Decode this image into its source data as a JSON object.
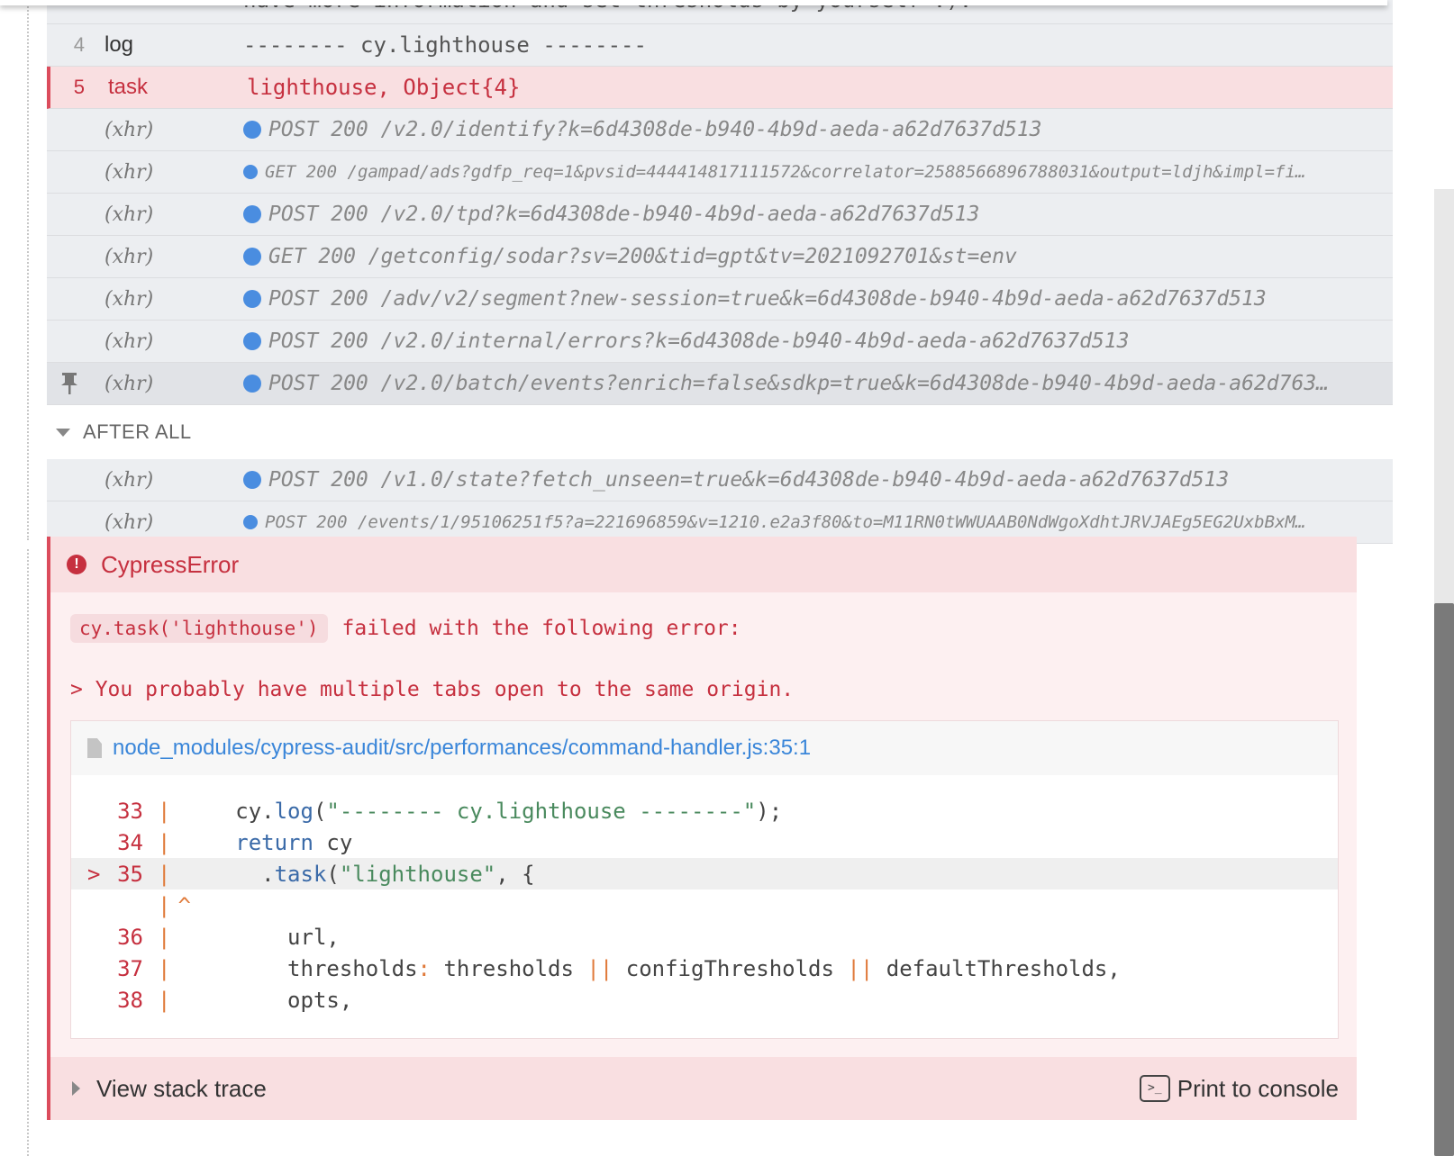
{
  "commands": [
    {
      "num": "",
      "name": "",
      "message": "have more information and set thresholds by yourself :)."
    },
    {
      "num": "4",
      "name": "log",
      "message": "-------- cy.lighthouse --------"
    },
    {
      "num": "5",
      "name": "task",
      "message": "lighthouse, Object{4}"
    }
  ],
  "xhr_label": "(xhr)",
  "xhr_requests": [
    "POST 200 /v2.0/identify?k=6d4308de-b940-4b9d-aeda-a62d7637d513",
    "GET 200 /gampad/ads?gdfp_req=1&pvsid=4444148171115​72&correlator=2588566896788031&output=ldjh&impl=fi…",
    "POST 200 /v2.0/tpd?k=6d4308de-b940-4b9d-aeda-a62d7637d513",
    "GET 200 /getconfig/sodar?sv=200&tid=gpt&tv=2021092701&st=env",
    "POST 200 /adv/v2/segment?new-session=true&k=6d4308de-b940-4b9d-aeda-a62d7637d513",
    "POST 200 /v2.0/internal/errors?k=6d4308de-b940-4b9d-aeda-a62d7637d513",
    "POST 200 /v2.0/batch/events?enrich=false&sdkp=true&k=6d4308de-b940-4b9d-aeda-a62d763…"
  ],
  "after_all": {
    "label": "AFTER ALL",
    "requests": [
      "POST 200 /v1.0/state?fetch_unseen=true&k=6d4308de-b940-4b9d-aeda-a62d7637d513",
      "POST 200 /events/1/95106251f5?a=221696859&v=1210.e2a3f80&to=M11RN0tWWUAAB0NdWgoXdhtJRVJAEg5EG2UxbBxM…"
    ]
  },
  "error": {
    "title": "CypressError",
    "code_chip": "cy.task('lighthouse')",
    "message_rest": "failed with the following error:",
    "message_line2": "> You probably have multiple tabs open to the same origin.",
    "file_path": "node_modules/cypress-audit/src/performances/command-handler.js:35:1",
    "code_lines": [
      {
        "ln": "33",
        "text": "    cy.log(\"-------- cy.lighthouse --------\");"
      },
      {
        "ln": "34",
        "text": "    return cy"
      },
      {
        "ln": "35",
        "text": "      .task(\"lighthouse\", {",
        "highlight": true
      },
      {
        "ln": "",
        "text": "^"
      },
      {
        "ln": "36",
        "text": "        url,"
      },
      {
        "ln": "37",
        "text": "        thresholds: thresholds || configThresholds || defaultThresholds,"
      },
      {
        "ln": "38",
        "text": "        opts,"
      }
    ],
    "view_stack_trace": "View stack trace",
    "print_to_console": "Print to console"
  }
}
